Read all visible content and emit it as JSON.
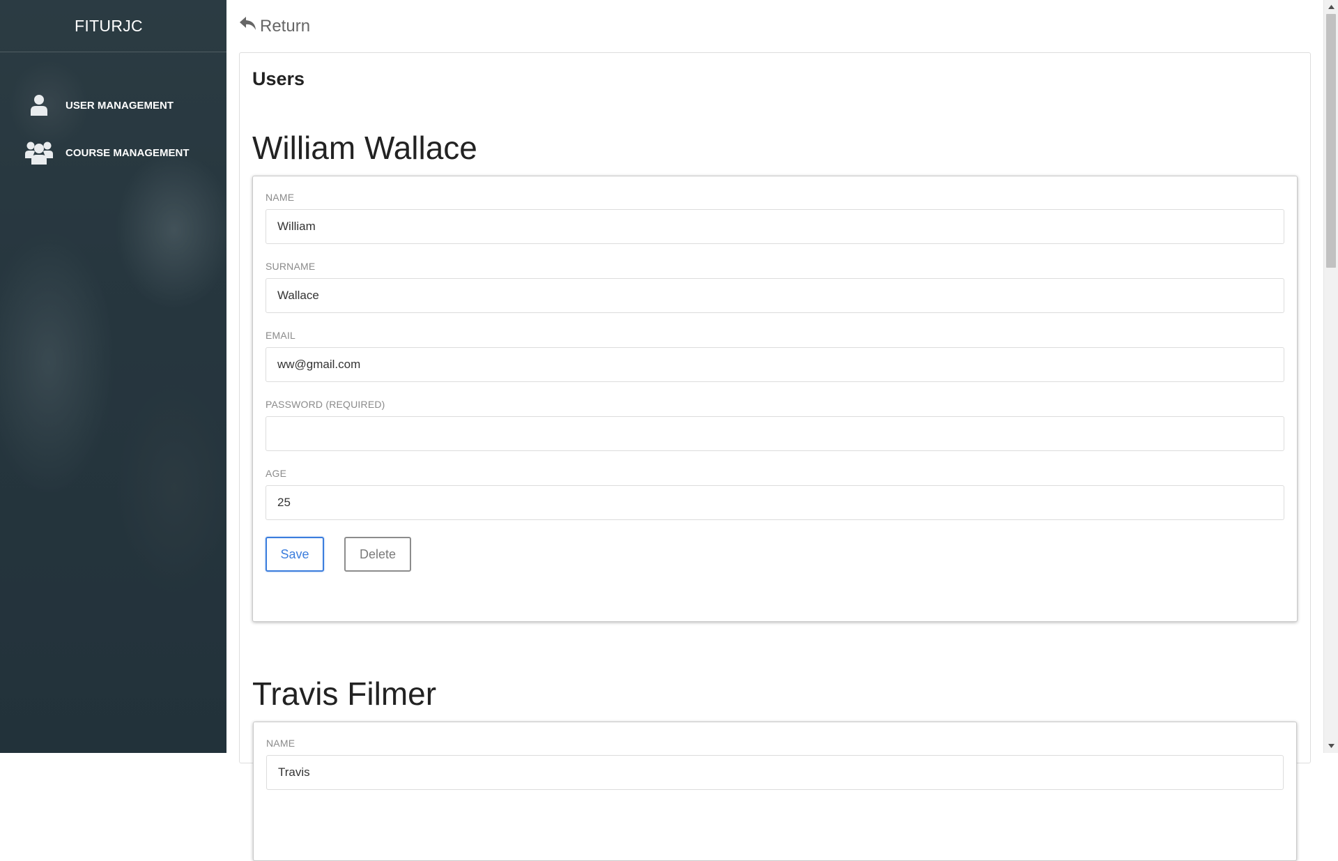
{
  "sidebar": {
    "brand": "FITURJC",
    "items": [
      {
        "label": "USER MANAGEMENT",
        "icon": "user-icon"
      },
      {
        "label": "COURSE MANAGEMENT",
        "icon": "users-group-icon"
      }
    ]
  },
  "topbar": {
    "return_label": "Return",
    "return_icon": "reply-arrow-icon"
  },
  "main": {
    "section_title": "Users",
    "users": [
      {
        "full_name": "William Wallace",
        "fields": {
          "name_label": "NAME",
          "name_value": "William",
          "surname_label": "SURNAME",
          "surname_value": "Wallace",
          "email_label": "EMAIL",
          "email_value": "ww@gmail.com",
          "password_label": "PASSWORD (REQUIRED)",
          "password_value": "",
          "age_label": "AGE",
          "age_value": "25"
        },
        "save_label": "Save",
        "delete_label": "Delete"
      },
      {
        "full_name": "Travis Filmer",
        "fields": {
          "name_label": "NAME",
          "name_value": "Travis"
        }
      }
    ]
  },
  "colors": {
    "accent": "#3b7ddd",
    "sidebar_bg": "#2d3c44",
    "label_gray": "#8a8a8a"
  }
}
